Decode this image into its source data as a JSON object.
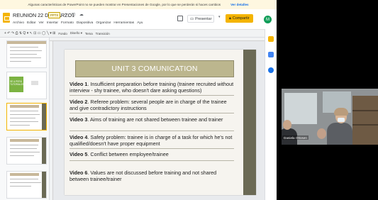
{
  "banner": {
    "message": "Algunas características de PowerPoint no se pueden mostrar en Presentaciones de Google, por lo que se perderán si haces cambios",
    "details": "Ver detalles"
  },
  "header": {
    "title": "REUNION 22 DE MARZO1",
    "badge": "PPTX",
    "title_icons": "☆ ⊡ ☁",
    "menu": [
      "Archivo",
      "Editar",
      "Ver",
      "Insertar",
      "Formato",
      "Diapositiva",
      "Organizar",
      "Herramientas",
      "Ayu"
    ],
    "present_label": "Presentar",
    "share_label": "Compartir",
    "avatar_initial": "M"
  },
  "toolbar": {
    "icons": "+ ↶ ↷ ⎙ ⇅  Q ▾  ↖ ⊡ ▭ ◯ ╲ ▾  ⊞",
    "fondo": "Fondo",
    "diseno": "Diseño ▾",
    "tema": "Tema",
    "transicion": "Transición"
  },
  "filmstrip": {
    "slide_numbers": [
      "",
      "",
      "",
      "",
      "",
      ""
    ],
    "thumb2_text": "SE & PERÚ TUTORIALES"
  },
  "slide": {
    "title": "UNIT 3 COMUNICATION",
    "items": [
      {
        "label": "Video 1",
        "text": ". Insufficient preparation before training (trainee recruited without interview - shy trainee, who doesn't dare asking questions)"
      },
      {
        "label": "Video 2",
        "text": ". Referee problem: several people are in charge of the trainee and give contradictory instructions"
      },
      {
        "label": "Video 3",
        "text": ". Aims of training are not shared between trainee and trainer"
      },
      {
        "label": "Video 4",
        "text": ". Safety problem: trainee is in charge of a task for which he's not qualified/doesn't have proper equipment"
      },
      {
        "label": "Video 5",
        "text": ". Conflict between employee/trainee"
      },
      {
        "label": "Video 6",
        "text": ". Values are not discussed before training and not shared between trainee/trainer"
      }
    ]
  },
  "webcam": {
    "participant_name": "Daniela Ottosen"
  },
  "colors": {
    "accent": "#f4b400",
    "title_box": "#bcb68e",
    "slide_stripe": "#6b6a55",
    "avatar": "#0f9d58"
  }
}
